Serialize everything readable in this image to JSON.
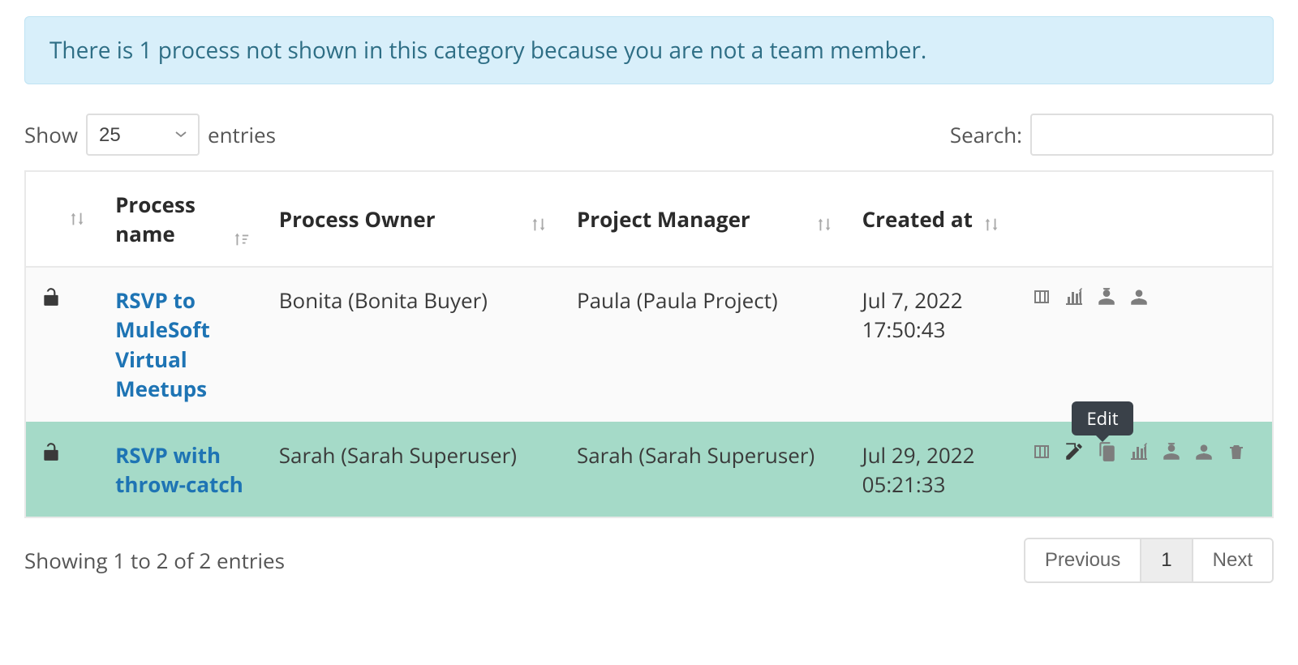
{
  "alert": {
    "text": "There is 1 process not shown in this category because you are not a team member."
  },
  "controls": {
    "show_label": "Show",
    "entries_label": "entries",
    "entries_selected": "25",
    "search_label": "Search:",
    "search_value": ""
  },
  "columns": {
    "status": "",
    "name": "Process name",
    "owner": "Process Owner",
    "pm": "Project Manager",
    "created": "Created at",
    "actions": ""
  },
  "rows": [
    {
      "status": "unlocked",
      "name": "RSVP to MuleSoft Virtual Meetups",
      "owner": "Bonita (Bonita Buyer)",
      "pm": "Paula (Paula Project)",
      "created": "Jul 7, 2022 17:50:43",
      "actions": [
        "columns",
        "chart",
        "owner",
        "pm"
      ],
      "rowClass": "row-odd"
    },
    {
      "status": "unlocked",
      "name": "RSVP with throw-catch",
      "owner": "Sarah (Sarah Superuser)",
      "pm": "Sarah (Sarah Superuser)",
      "created": "Jul 29, 2022 05:21:33",
      "actions": [
        "columns",
        "edit",
        "copy",
        "chart",
        "owner",
        "pm",
        "trash"
      ],
      "rowClass": "row-hover",
      "tooltip": "Edit",
      "tooltipOn": "edit"
    }
  ],
  "footer": {
    "info": "Showing 1 to 2 of 2 entries",
    "prev": "Previous",
    "page": "1",
    "next": "Next"
  },
  "icon_titles": {
    "columns": "columns-icon",
    "edit": "edit-icon",
    "copy": "copy-icon",
    "chart": "chart-icon",
    "owner": "owner-icon",
    "pm": "pm-icon",
    "trash": "trash-icon"
  }
}
